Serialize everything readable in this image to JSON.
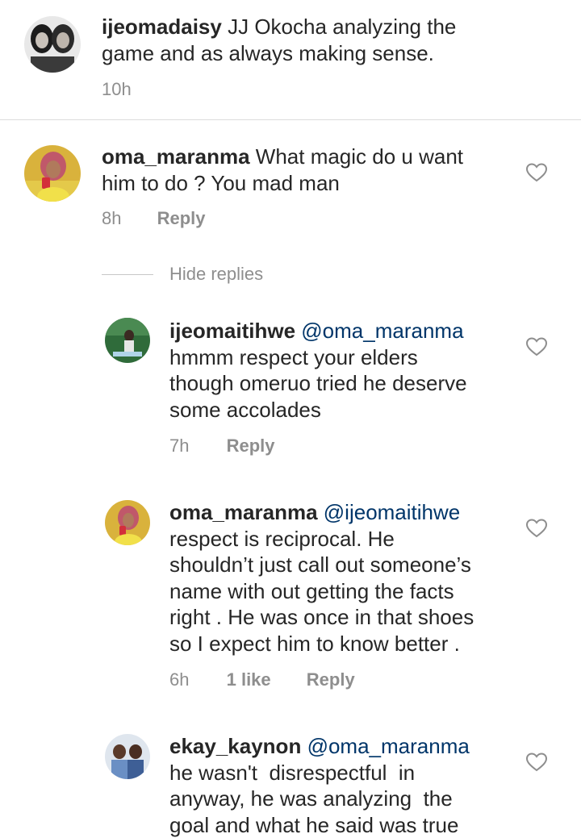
{
  "caption": {
    "username": "ijeomadaisy",
    "lines": [
      "JJ Okocha analyzing the",
      "game and as always making sense."
    ],
    "time": "10h"
  },
  "comments": [
    {
      "username": "oma_maranma",
      "lines": [
        "What magic do u want",
        "him to do ? You mad man"
      ],
      "time": "8h",
      "reply_label": "Reply"
    }
  ],
  "hide_replies_label": "Hide replies",
  "replies": [
    {
      "username": "ijeomaitihwe",
      "mention": "@oma_maranma",
      "lines": [
        "hmmm respect your elders",
        "though omeruo tried he deserve",
        "some accolades"
      ],
      "time": "7h",
      "reply_label": "Reply"
    },
    {
      "username": "oma_maranma",
      "mention": "@ijeomaitihwe",
      "lines": [
        "respect is reciprocal. He",
        "shouldn’t just call out someone’s",
        "name with out getting the facts",
        "right . He was once in that shoes",
        "so I expect him to know better ."
      ],
      "time": "6h",
      "likes": "1 like",
      "reply_label": "Reply"
    },
    {
      "username": "ekay_kaynon",
      "mention": "@oma_maranma",
      "lines": [
        "he wasn't  disrespectful  in",
        "anyway, he was analyzing  the",
        "goal and what he said was true"
      ]
    }
  ],
  "icons": {
    "like": "heart-outline-icon"
  },
  "colors": {
    "text": "#262626",
    "meta": "#8e8e8e",
    "mention": "#003569",
    "divider": "#dbdbdb"
  }
}
